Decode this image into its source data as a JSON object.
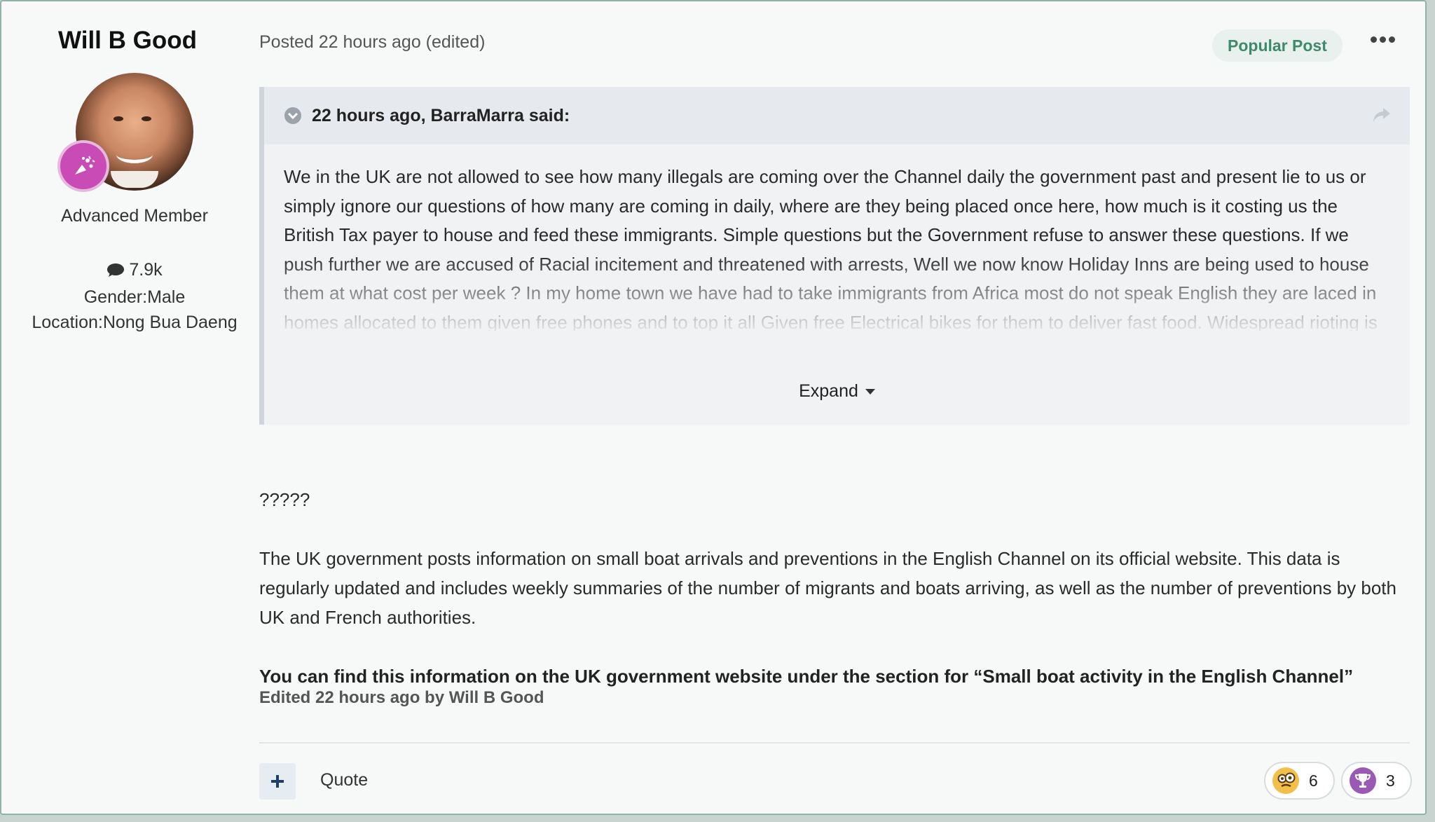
{
  "author": {
    "name": "Will B Good",
    "member_title": "Advanced Member",
    "post_count": "7.9k",
    "gender": "Gender:Male",
    "location": "Location:Nong Bua Daeng"
  },
  "post_meta": {
    "posted": "Posted 22 hours ago (edited)",
    "badge": "Popular Post"
  },
  "quote": {
    "citation": "22 hours ago, BarraMarra said:",
    "text": "We in the UK are not allowed to see how many illegals are coming over the Channel daily the government past and present lie to us or simply ignore our questions of how many are coming in daily, where are they being placed once here, how much is it costing us the British Tax payer to house and feed these immigrants. Simple questions but the Government refuse to answer these questions. If we push further we are accused of Racial incitement and threatened with arrests, Well we now know Holiday Inns are being used to house them at what cost per week ? In my home town we have had to take immigrants from Africa most do not speak English they are laced in homes allocated to them given free phones and to top it all Given free Electrical bikes for them to deliver fast food. Widespread rioting is now in place throughout the UK were not all right wing thugs or hooligans don't",
    "expand_label": "Expand"
  },
  "post": {
    "line1": "?????",
    "line2": "The UK government posts information on small boat arrivals and preventions in the English Channel on its official website. This data is regularly updated and includes weekly summaries of the number of migrants and boats arriving, as well as the number of preventions by both UK and French authorities.",
    "line3": "You can find this information on the UK government website under the section for “Small boat activity in the English Channel”",
    "edited": "Edited 22 hours ago by Will B Good"
  },
  "actions": {
    "quote_label": "Quote"
  },
  "reactions": [
    {
      "icon": "confused-emoji-icon",
      "count": "6"
    },
    {
      "icon": "trophy-icon",
      "count": "3"
    }
  ],
  "colors": {
    "accent_green": "#3e8a6b",
    "badge_purple": "#c84bb6",
    "plus_blue": "#1f3f66"
  }
}
